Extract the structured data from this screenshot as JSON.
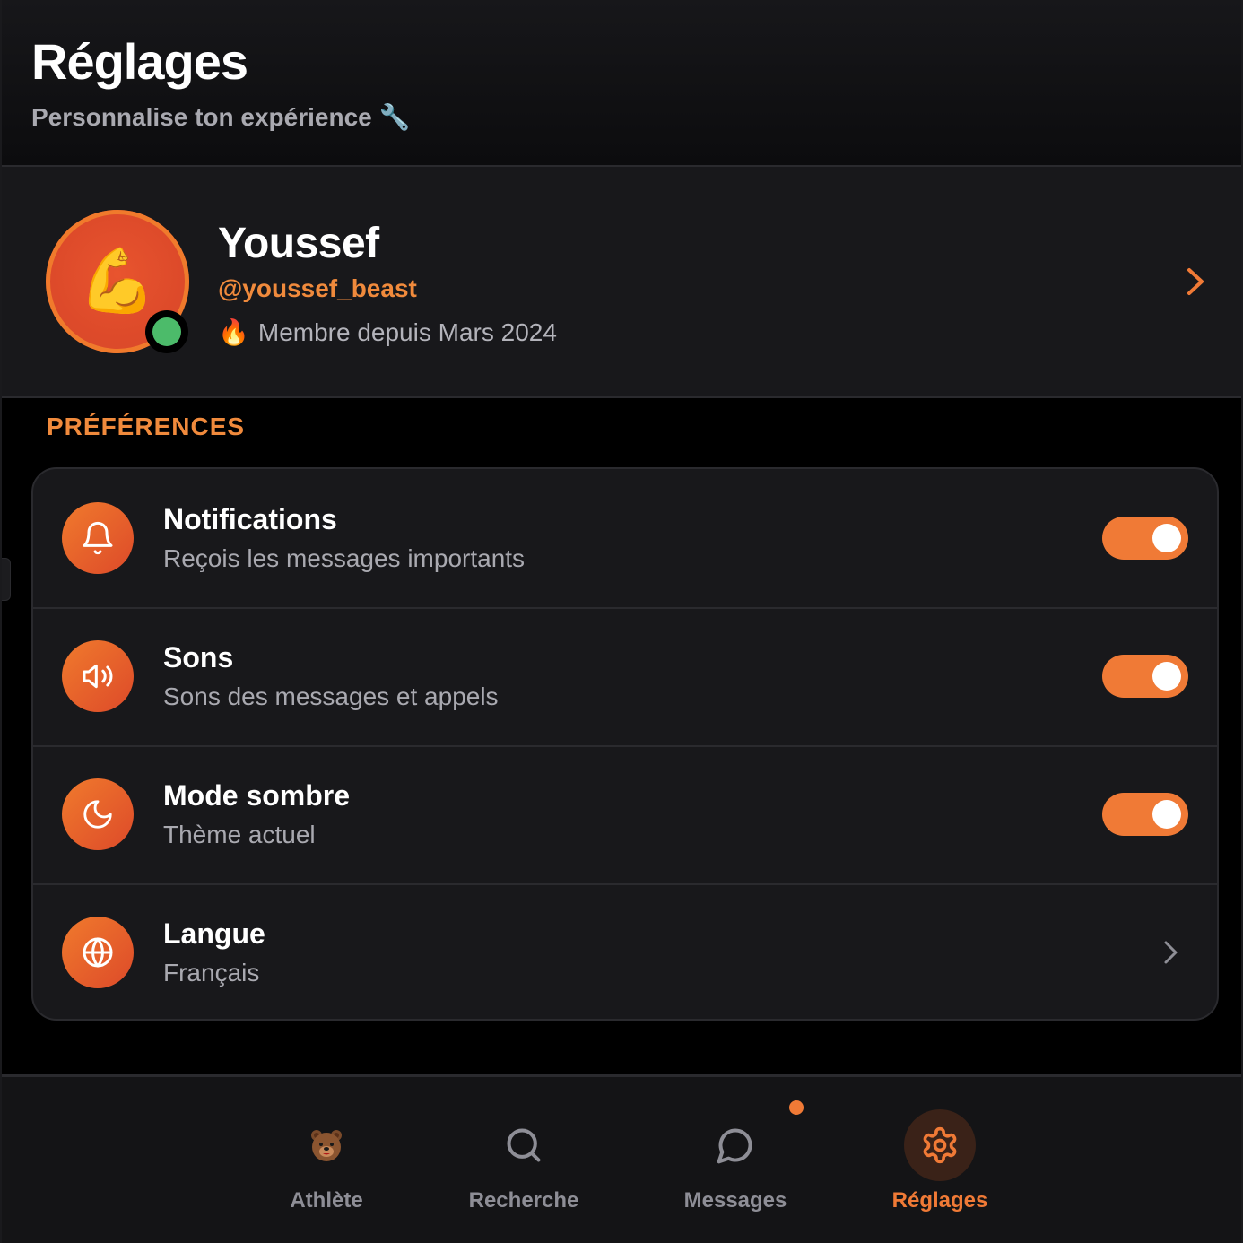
{
  "header": {
    "title": "Réglages",
    "subtitle": "Personnalise ton expérience 🔧"
  },
  "profile": {
    "avatar_emoji": "💪",
    "name": "Youssef",
    "handle": "@youssef_beast",
    "member_emoji": "🔥",
    "member_since": "Membre depuis Mars 2024",
    "status": "online"
  },
  "preferences": {
    "section_title": "PRÉFÉRENCES",
    "items": [
      {
        "title": "Notifications",
        "subtitle": "Reçois les messages importants",
        "icon": "bell-icon",
        "control": "toggle",
        "enabled": true
      },
      {
        "title": "Sons",
        "subtitle": "Sons des messages et appels",
        "icon": "speaker-icon",
        "control": "toggle",
        "enabled": true
      },
      {
        "title": "Mode sombre",
        "subtitle": "Thème actuel",
        "icon": "moon-icon",
        "control": "toggle",
        "enabled": true
      },
      {
        "title": "Langue",
        "subtitle": "Français",
        "icon": "globe-icon",
        "control": "chevron"
      }
    ]
  },
  "nav": {
    "items": [
      {
        "label": "Athlète",
        "icon": "bear-icon",
        "active": false
      },
      {
        "label": "Recherche",
        "icon": "search-icon",
        "active": false
      },
      {
        "label": "Messages",
        "icon": "chat-icon",
        "active": false,
        "badge": true
      },
      {
        "label": "Réglages",
        "icon": "gear-icon",
        "active": true
      }
    ]
  },
  "colors": {
    "accent": "#f07a36",
    "background": "#000000",
    "card": "#18181b",
    "online": "#4cbb6a"
  }
}
